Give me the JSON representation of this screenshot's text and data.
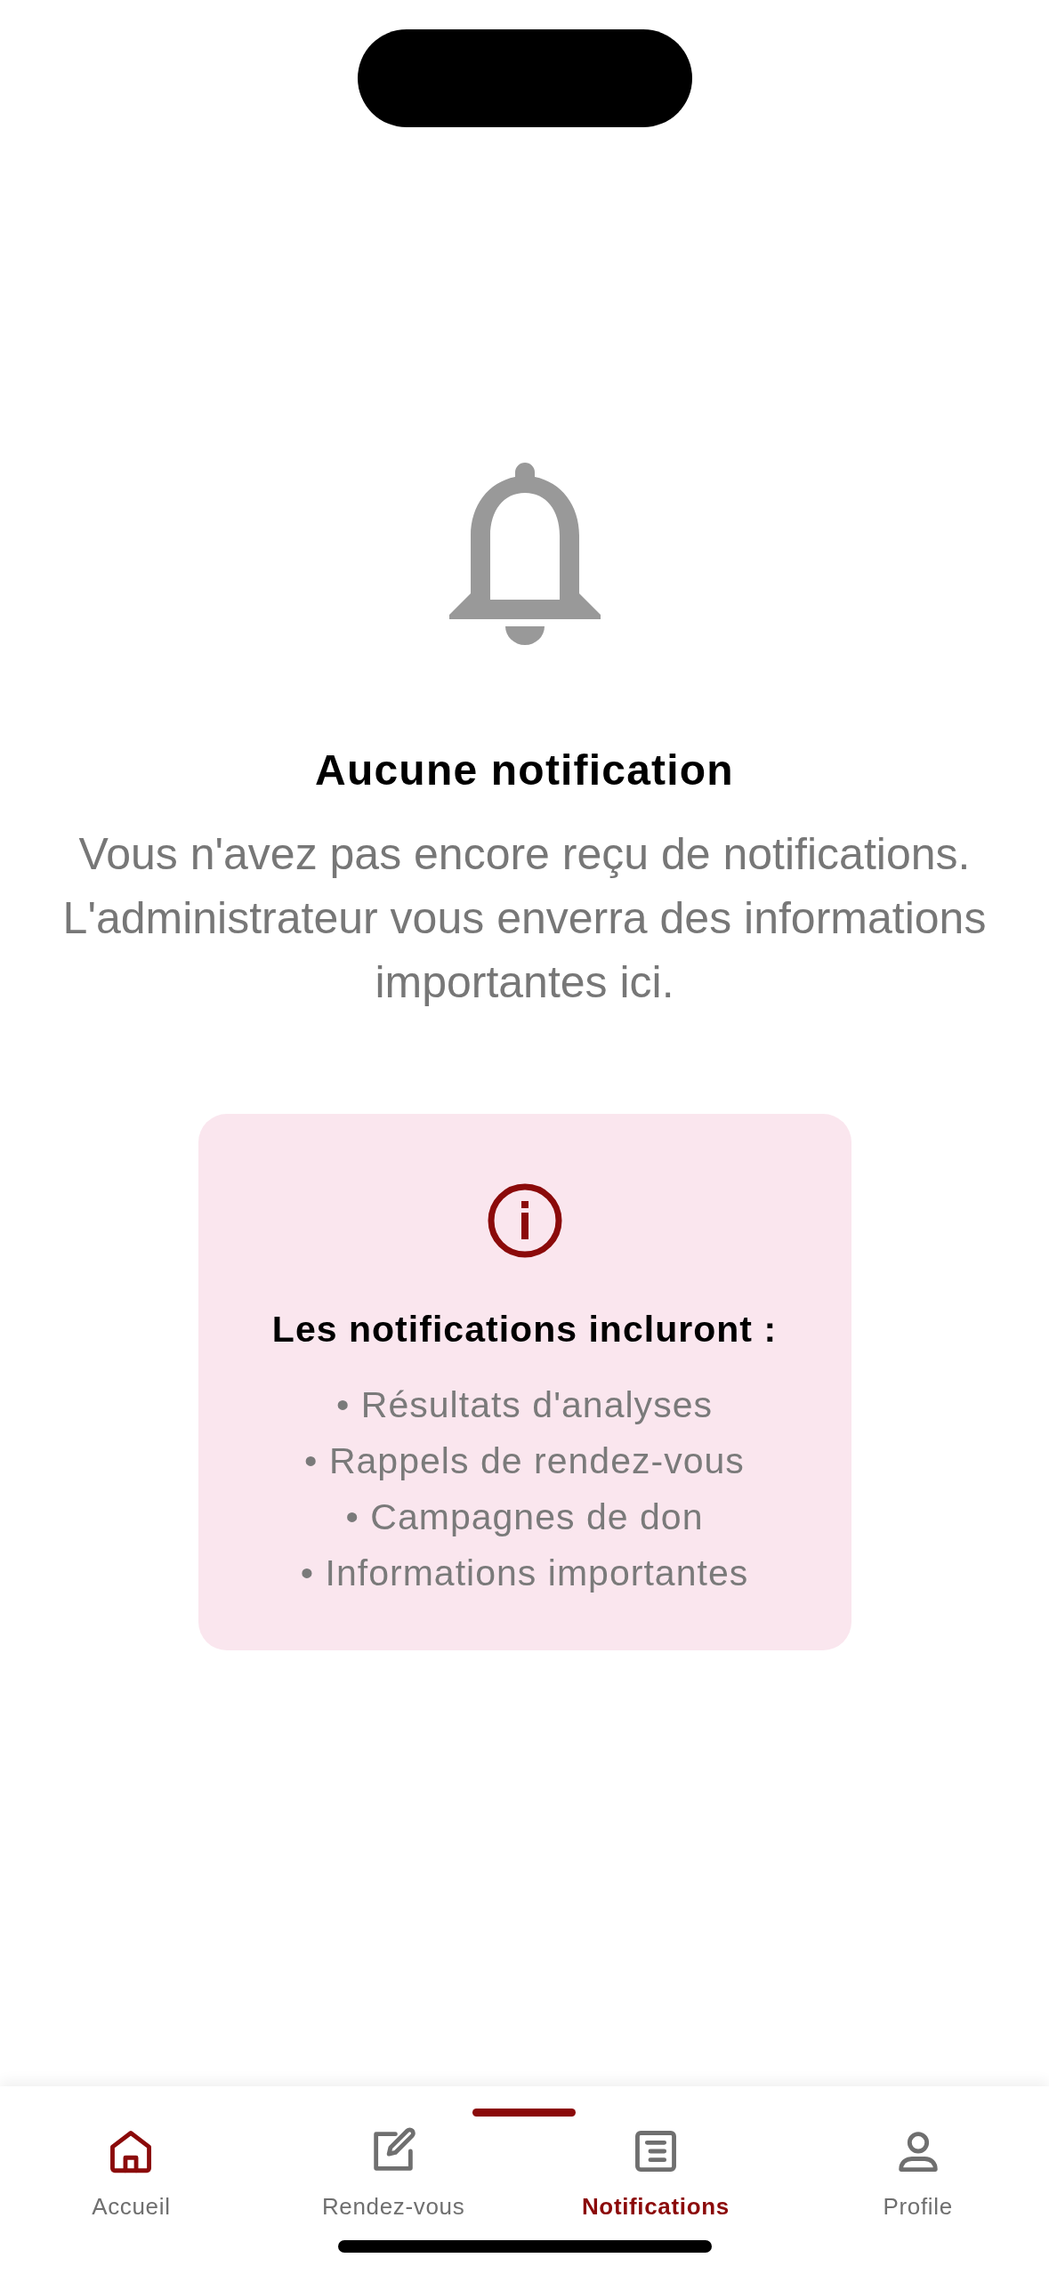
{
  "empty_state": {
    "title": "Aucune notification",
    "message": "Vous n'avez pas encore reçu de notifications. L'administrateur vous enverra des informations importantes ici."
  },
  "info_card": {
    "heading": "Les notifications incluront :",
    "items": [
      "• Résultats d'analyses",
      "• Rappels de rendez-vous",
      "• Campagnes de don",
      "• Informations importantes"
    ]
  },
  "tab_bar": [
    {
      "kind": "home",
      "label": "Accueil",
      "selected": false,
      "icon_active": true
    },
    {
      "kind": "edit",
      "label": "Rendez-vous",
      "selected": false,
      "icon_active": false
    },
    {
      "kind": "list",
      "label": "Notifications",
      "selected": true,
      "icon_active": false
    },
    {
      "kind": "person",
      "label": "Profile",
      "selected": false,
      "icon_active": false
    }
  ]
}
